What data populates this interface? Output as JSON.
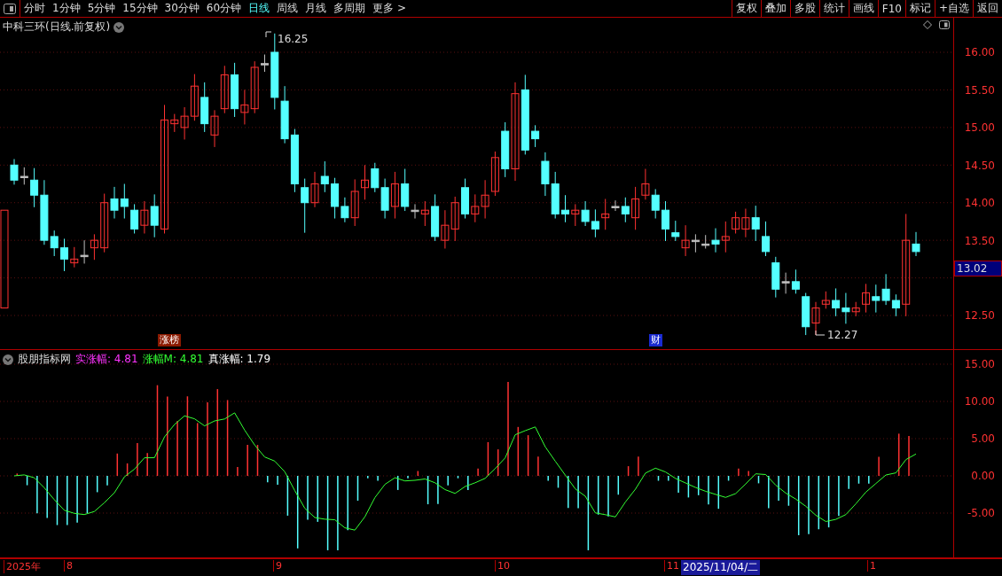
{
  "toolbar": {
    "periods": [
      {
        "label": "分时",
        "selected": false
      },
      {
        "label": "1分钟",
        "selected": false
      },
      {
        "label": "5分钟",
        "selected": false
      },
      {
        "label": "15分钟",
        "selected": false
      },
      {
        "label": "30分钟",
        "selected": false
      },
      {
        "label": "60分钟",
        "selected": false
      },
      {
        "label": "日线",
        "selected": true
      },
      {
        "label": "周线",
        "selected": false
      },
      {
        "label": "月线",
        "selected": false
      },
      {
        "label": "多周期",
        "selected": false
      },
      {
        "label": "更多 >",
        "selected": false
      }
    ],
    "buttons": [
      "复权",
      "叠加",
      "多股",
      "统计",
      "画线",
      "F10",
      "标记",
      "+自选",
      "返回"
    ]
  },
  "price_chart": {
    "title": "中科三环(日线.前复权)",
    "y_ticks": [
      "16.00",
      "15.50",
      "15.00",
      "14.50",
      "14.00",
      "13.50",
      "12.50"
    ],
    "current_price": "13.02",
    "high_label": "16.25",
    "low_label": "12.27",
    "markers": [
      {
        "label": "涨榜",
        "color": "#8b1a00"
      },
      {
        "label": "财",
        "color": "#1a2ad0"
      }
    ]
  },
  "indicator": {
    "name": "股朋指标网",
    "metrics": [
      {
        "label": "实涨幅: 4.81",
        "color": "#ff33ff"
      },
      {
        "label": "涨幅M: 4.81",
        "color": "#33ff33"
      },
      {
        "label": "真涨幅: 1.79",
        "color": "#ffffff"
      }
    ],
    "y_ticks": [
      "15.00",
      "10.00",
      "5.00",
      "0.00",
      "-5.00"
    ]
  },
  "date_axis": {
    "labels": [
      "2025年",
      "8",
      "9",
      "10",
      "11"
    ],
    "cursor_date": "2025/11/04/二",
    "trailing_label": "1"
  }
}
